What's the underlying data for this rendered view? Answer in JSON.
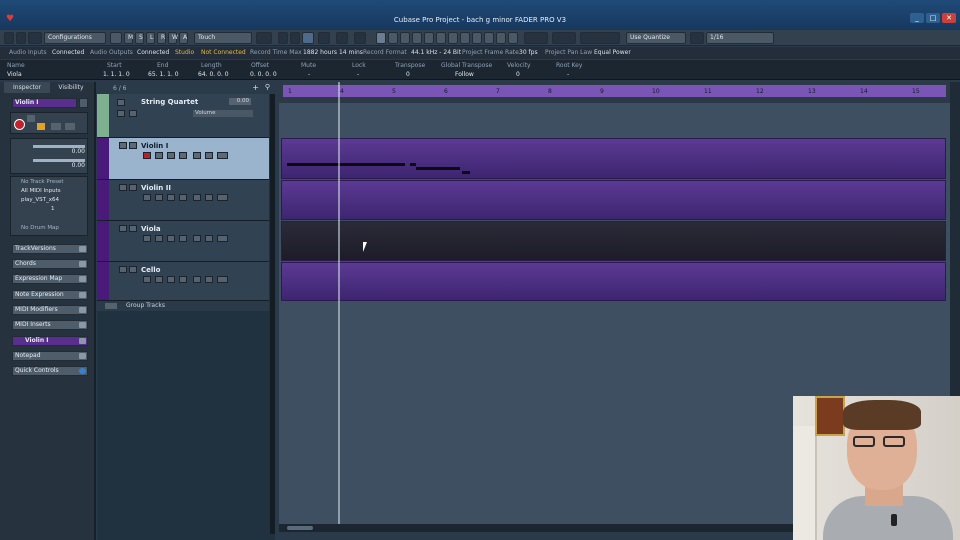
{
  "window": {
    "title": "Cubase Pro Project - bach g minor FADER PRO V3",
    "min_label": "_",
    "max_label": "□",
    "close_label": "✕"
  },
  "toolbar": {
    "configurations": "Configurations",
    "modes": [
      "M",
      "S",
      "L",
      "R",
      "W",
      "A"
    ],
    "automation_mode": "Touch",
    "quantize_mode": "Use Quantize",
    "quantize_value": "1/16"
  },
  "statusbar": {
    "audio_inputs_label": "Audio Inputs",
    "audio_inputs_value": "Connected",
    "audio_outputs_label": "Audio Outputs",
    "audio_outputs_value": "Connected",
    "studio_label": "Studio",
    "studio_value": "Not Connected",
    "record_time_max_label": "Record Time Max",
    "record_time_max_value": "1882 hours 14 mins",
    "record_format_label": "Record Format",
    "record_format_value": "44.1 kHz - 24 Bit",
    "frame_rate_label": "Project Frame Rate",
    "frame_rate_value": "30 fps",
    "pan_law_label": "Project Pan Law",
    "pan_law_value": "Equal Power"
  },
  "infoline": {
    "name_label": "Name",
    "name_value": "Viola",
    "start_label": "Start",
    "start_value": "1. 1. 1. 0",
    "end_label": "End",
    "end_value": "65. 1. 1. 0",
    "length_label": "Length",
    "length_value": "64. 0. 0. 0",
    "offset_label": "Offset",
    "offset_value": "0. 0. 0. 0",
    "mute_label": "Mute",
    "mute_value": "-",
    "lock_label": "Lock",
    "lock_value": "-",
    "transpose_label": "Transpose",
    "transpose_value": "0",
    "global_transpose_label": "Global Transpose",
    "global_transpose_value": "Follow",
    "velocity_label": "Velocity",
    "velocity_value": "0",
    "root_key_label": "Root Key",
    "root_key_value": "-"
  },
  "inspector": {
    "tabs": [
      "Inspector",
      "Visibility"
    ],
    "track_name": "Violin I",
    "volume_value": "0.00",
    "pan_value": "0.00",
    "no_track_preset": "No Track Preset",
    "midi_input": "All MIDI Inputs",
    "midi_output": "play_VST_x64",
    "channel": "1",
    "no_drum_map": "No Drum Map",
    "sections": [
      "TrackVersions",
      "Chords",
      "Expression Map",
      "Note Expression",
      "MIDI Modifiers",
      "MIDI Inserts",
      "Violin I",
      "Notepad",
      "Quick Controls"
    ]
  },
  "tracklist": {
    "counter": "6 / 6",
    "tracks": [
      {
        "name": "String Quartet",
        "volume": "0.00",
        "volume_label": "Volume"
      },
      {
        "name": "Violin I"
      },
      {
        "name": "Violin II"
      },
      {
        "name": "Viola"
      },
      {
        "name": "Cello"
      }
    ],
    "group_tracks": "Group Tracks"
  },
  "ruler": {
    "bars": [
      "1",
      "4",
      "5",
      "6",
      "7",
      "8",
      "9",
      "10",
      "11",
      "12",
      "13",
      "14",
      "15"
    ]
  },
  "colors": {
    "track_color": "#5a2e8f",
    "event_purple": "#5b3a93",
    "folder_color": "#7fb08f",
    "selected_track": "#9ab4ce",
    "record_red": "#b8202a"
  }
}
